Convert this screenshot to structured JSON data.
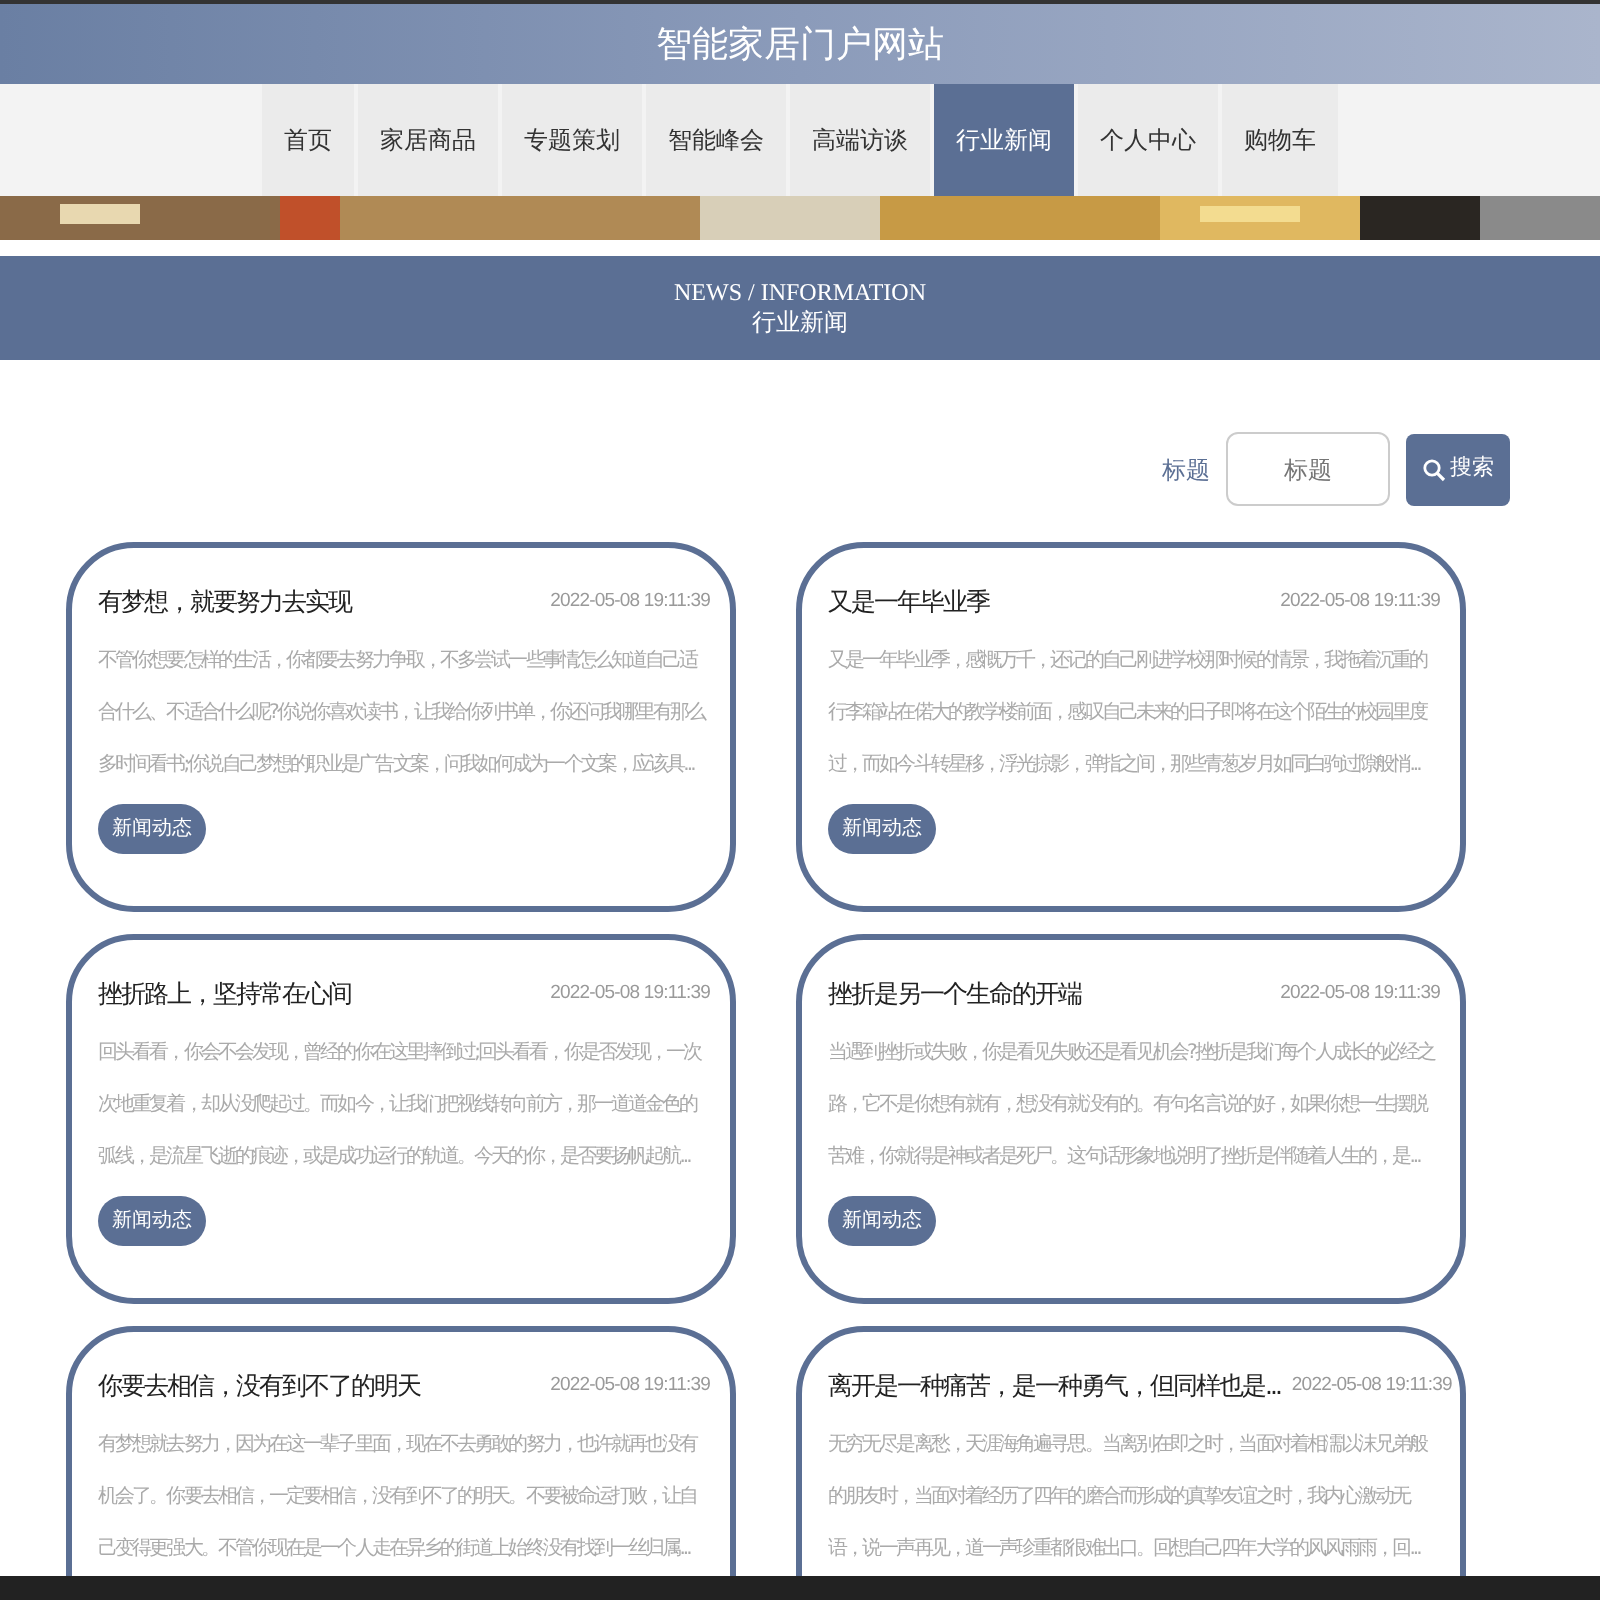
{
  "site_title": "智能家居门户网站",
  "nav": [
    {
      "label": "首页",
      "selected": false
    },
    {
      "label": "家居商品",
      "selected": false
    },
    {
      "label": "专题策划",
      "selected": false
    },
    {
      "label": "智能峰会",
      "selected": false
    },
    {
      "label": "高端访谈",
      "selected": false
    },
    {
      "label": "行业新闻",
      "selected": true
    },
    {
      "label": "个人中心",
      "selected": false
    },
    {
      "label": "购物车",
      "selected": false
    }
  ],
  "section": {
    "title_en": "NEWS / INFORMATION",
    "title": "行业新闻"
  },
  "search": {
    "label": "标题",
    "placeholder": "标题",
    "button": "搜索"
  },
  "articles": [
    {
      "title": "有梦想，就要努力去实现",
      "date": "2022-05-08 19:11:39",
      "excerpt": "不管你想要怎样的生活，你都要去努力争取，不多尝试一些事情怎么知道自己适合什么、不适合什么呢?你说你喜欢读书，让我给你列书单，你还问我哪里有那么多时间看书;你说自己梦想的职业是广告文案，问我如何成为一个文案，应该具...",
      "tag": "新闻动态"
    },
    {
      "title": "又是一年毕业季",
      "date": "2022-05-08 19:11:39",
      "excerpt": "又是一年毕业季，感慨万千，还记的自己刚进学校那时候的情景，我拖着沉重的行李箱站在偌大的教学楼前面，感叹自己未来的日子即将在这个陌生的校园里度过，而如今斗转星移，浮光掠影，弹指之间，那些青葱岁月如同白驹过隙般悄...",
      "tag": "新闻动态"
    },
    {
      "title": "挫折路上，坚持常在心间",
      "date": "2022-05-08 19:11:39",
      "excerpt": "回头看看，你会不会发现，曾经的你在这里摔倒过;回头看看，你是否发现，一次次地重复着，却从没爬起过。而如今，让我们把视线转向前方，那一道道金色的弧线，是流星飞逝的痕迹，或是成功运行的轨道。今天的你，是否要扬帆起航...",
      "tag": "新闻动态"
    },
    {
      "title": "挫折是另一个生命的开端",
      "date": "2022-05-08 19:11:39",
      "excerpt": "当遇到挫折或失败，你是看见失败还是看见机会?挫折是我们每个人成长的必经之路，它不是你想有就有，想没有就没有的。有句名言说的好，如果你想一生摆脱苦难，你就得是神或者是死尸。这句话形象地说明了挫折是伴随着人生的，是...",
      "tag": "新闻动态"
    },
    {
      "title": "你要去相信，没有到不了的明天",
      "date": "2022-05-08 19:11:39",
      "excerpt": "有梦想就去努力，因为在这一辈子里面，现在不去勇敢的努力，也许就再也没有机会了。你要去相信，一定要相信，没有到不了的明天。不要被命运打败，让自己变得更强大。不管你现在是一个人走在异乡的街道上始终没有找到一丝归属..."
    },
    {
      "title": "离开是一种痛苦，是一种勇气，但同样也是...",
      "date": "2022-05-08 19:11:39",
      "excerpt": "无穷无尽是离愁，天涯海角遍寻思。当离别在即之时，当面对着相濡以沫兄弟般的朋友时，当面对着经历了四年的磨合而形成的真挚友谊之时，我内心激动无语，说一声再见，道一声珍重都很难出口。回想自己四年大学的风风雨雨，回..."
    }
  ]
}
